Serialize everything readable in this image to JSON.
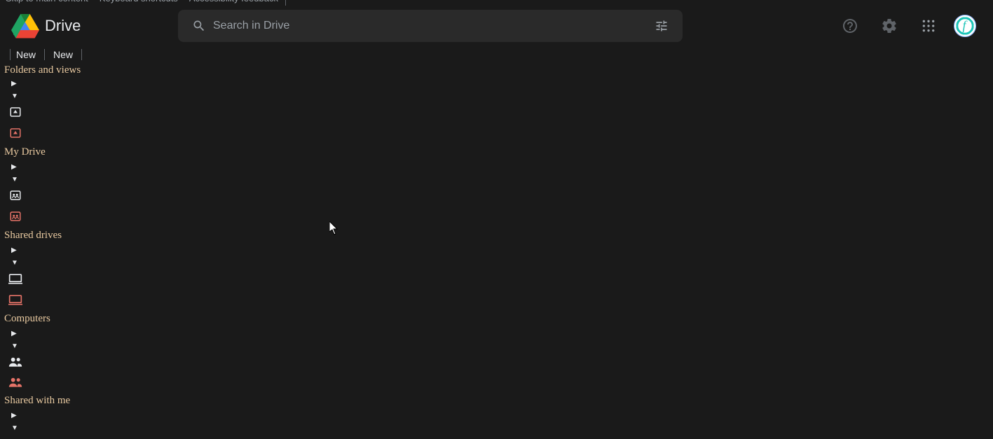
{
  "skip_links": {
    "main_content": "Skip to main content",
    "keyboard_shortcuts": "Keyboard shortcuts",
    "accessibility_feedback": "Accessibility feedback"
  },
  "header": {
    "app_name": "Drive",
    "search_placeholder": "Search in Drive"
  },
  "avatar": {
    "initial": "f"
  },
  "sidebar": {
    "new1": "New",
    "new2": "New",
    "sections": {
      "folders_views": "Folders and views",
      "my_drive": "My Drive",
      "shared_drives": "Shared drives",
      "computers": "Computers",
      "shared_with_me": "Shared with me"
    }
  }
}
